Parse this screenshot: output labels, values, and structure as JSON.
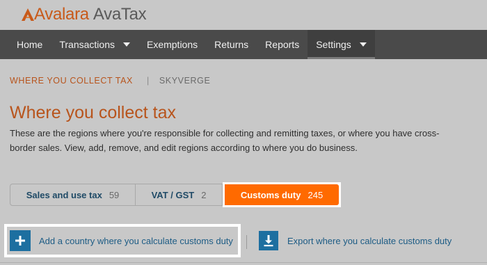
{
  "brand": {
    "wordmark": "Avalara",
    "product": "AvaTax",
    "logo_icon": "avalara-a-logo",
    "brand_color": "#c85a1a"
  },
  "nav": {
    "items": [
      {
        "label": "Home",
        "has_dropdown": false
      },
      {
        "label": "Transactions",
        "has_dropdown": true
      },
      {
        "label": "Exemptions",
        "has_dropdown": false
      },
      {
        "label": "Returns",
        "has_dropdown": false
      },
      {
        "label": "Reports",
        "has_dropdown": false
      },
      {
        "label": "Settings",
        "has_dropdown": true,
        "active": true
      }
    ],
    "background": "#4a4a4a"
  },
  "breadcrumb": {
    "section": "WHERE YOU COLLECT TAX",
    "separator": "|",
    "company": "SKYVERGE"
  },
  "page": {
    "title": "Where you collect tax",
    "description": "These are the regions where you're responsible for collecting and remitting taxes, or where you have cross-border sales. View, add, remove, and edit regions according to where you do business."
  },
  "tabs": [
    {
      "label": "Sales and use tax",
      "count": "59"
    },
    {
      "label": "VAT / GST",
      "count": "2"
    },
    {
      "label": "Customs duty",
      "count": "245",
      "active": true
    }
  ],
  "actions": {
    "add_label": "Add a country where you calculate customs duty",
    "add_icon": "plus-icon",
    "export_label": "Export where you calculate customs duty",
    "export_icon": "download-icon"
  },
  "colors": {
    "accent": "#ff6a00",
    "title": "#b8541c",
    "link": "#1d5c85",
    "icon_bg": "#1d6fa0"
  }
}
